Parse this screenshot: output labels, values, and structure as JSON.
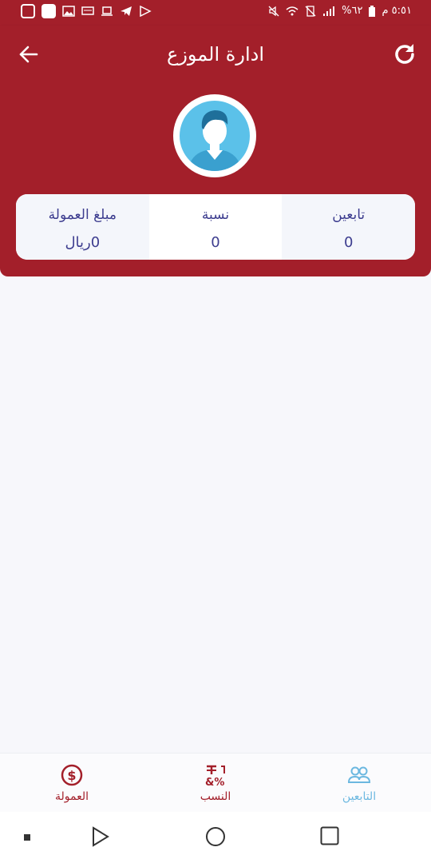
{
  "status_bar": {
    "time": "٥:٥١ م",
    "battery": "%٦٢"
  },
  "app_bar": {
    "title": "ادارة الموزع",
    "back_icon": "arrow-left-icon",
    "refresh_icon": "refresh-icon"
  },
  "profile": {
    "avatar_icon": "user-avatar-icon"
  },
  "stats": [
    {
      "label": "تابعين",
      "value": "0"
    },
    {
      "label": "نسبة",
      "value": "0"
    },
    {
      "label": "مبلغ العمولة",
      "value": "0ريال"
    }
  ],
  "bottom_nav": {
    "items": [
      {
        "label": "التابعين",
        "icon": "users-icon",
        "color": "#6cb8e0"
      },
      {
        "label": "النسب",
        "icon": "percent-icon",
        "color": "#a31f2a"
      },
      {
        "label": "العمولة",
        "icon": "dollar-icon",
        "color": "#a31f2a"
      }
    ]
  },
  "colors": {
    "primary": "#a31f2a",
    "text_blue": "#3d3d8f",
    "active_tab": "#6cb8e0"
  }
}
